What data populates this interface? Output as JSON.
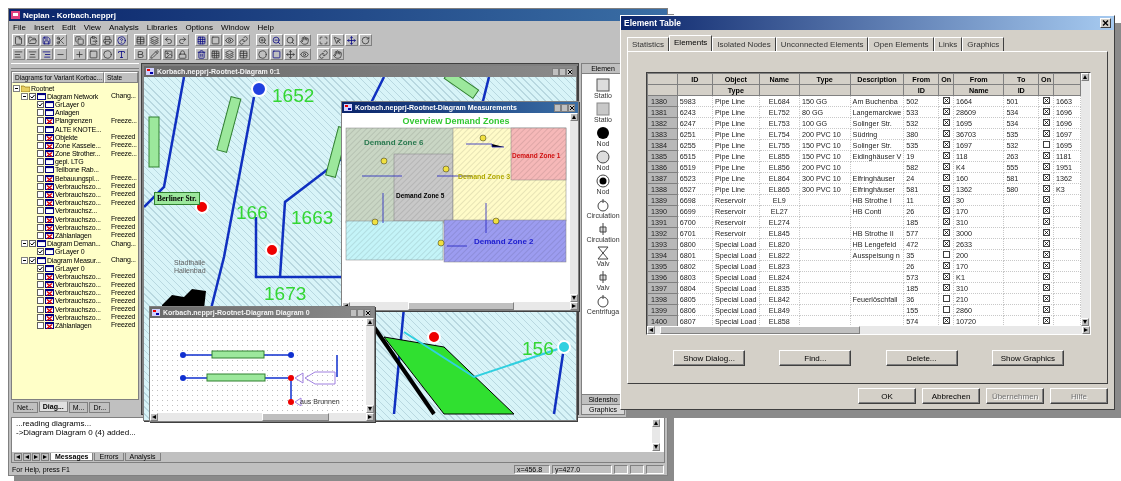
{
  "main_window": {
    "title": "Neplan - Korbach.nepprj",
    "menu": [
      "File",
      "Insert",
      "Edit",
      "View",
      "Analysis",
      "Libraries",
      "Options",
      "Window",
      "Help"
    ],
    "tree_panel": {
      "columns": [
        "Diagrams for Variant Korbac...",
        "State"
      ],
      "items": [
        {
          "label": "Rootnet",
          "kind": "folder",
          "expanded": true,
          "children": [
            {
              "label": "Diagram Network",
              "kind": "diagram",
              "checked": true,
              "state": "Chang...",
              "expanded": true,
              "children": [
                {
                  "label": "GrLayer 0",
                  "kind": "layer",
                  "checked": true
                },
                {
                  "label": "Anlagen",
                  "kind": "layer",
                  "checked": false
                },
                {
                  "label": "Plangrenzen",
                  "kind": "frozen-layer",
                  "checked": false,
                  "state": "Freeze..."
                },
                {
                  "label": "ALTE KNOTE...",
                  "kind": "layer",
                  "checked": false
                },
                {
                  "label": "Objekte",
                  "kind": "frozen-layer",
                  "checked": false,
                  "state": "Freezed"
                },
                {
                  "label": "Zone Kassele...",
                  "kind": "frozen-layer",
                  "checked": false,
                  "state": "Freeze..."
                },
                {
                  "label": "Zone Strother...",
                  "kind": "frozen-layer",
                  "checked": false,
                  "state": "Freeze..."
                },
                {
                  "label": "gepl. LTG",
                  "kind": "layer",
                  "checked": false
                },
                {
                  "label": "Teilbone Rab...",
                  "kind": "layer",
                  "checked": false
                },
                {
                  "label": "Bebauungspl...",
                  "kind": "frozen-layer",
                  "checked": false,
                  "state": "Freeze..."
                },
                {
                  "label": "Verbrauchszo...",
                  "kind": "frozen-layer",
                  "checked": false,
                  "state": "Freezed"
                },
                {
                  "label": "Verbrauchszo...",
                  "kind": "frozen-layer",
                  "checked": false,
                  "state": "Freezed"
                },
                {
                  "label": "Verbrauchszo...",
                  "kind": "frozen-layer",
                  "checked": false,
                  "state": "Freezed"
                },
                {
                  "label": "Verbrauchsz...",
                  "kind": "layer",
                  "checked": false
                },
                {
                  "label": "Verbrauchszo...",
                  "kind": "frozen-layer",
                  "checked": false,
                  "state": "Freezed"
                },
                {
                  "label": "Verbrauchszo...",
                  "kind": "frozen-layer",
                  "checked": false,
                  "state": "Freezed"
                },
                {
                  "label": "Zählanlagen",
                  "kind": "frozen-layer",
                  "checked": false,
                  "state": "Freezed"
                }
              ]
            },
            {
              "label": "Diagram Deman...",
              "kind": "diagram",
              "checked": true,
              "state": "Chang...",
              "expanded": true,
              "children": [
                {
                  "label": "GrLayer 0",
                  "kind": "layer",
                  "checked": true
                }
              ]
            },
            {
              "label": "Diagram Measur...",
              "kind": "diagram",
              "checked": true,
              "state": "Chang...",
              "expanded": true,
              "children": [
                {
                  "label": "GrLayer 0",
                  "kind": "layer",
                  "checked": true
                },
                {
                  "label": "Verbrauchszo...",
                  "kind": "frozen-layer",
                  "checked": false,
                  "state": "Freezed"
                },
                {
                  "label": "Verbrauchszo...",
                  "kind": "frozen-layer",
                  "checked": false,
                  "state": "Freezed"
                },
                {
                  "label": "Verbrauchszo...",
                  "kind": "frozen-layer",
                  "checked": false,
                  "state": "Freezed"
                },
                {
                  "label": "Verbrauchszo...",
                  "kind": "frozen-layer",
                  "checked": false,
                  "state": "Freezed"
                },
                {
                  "label": "Verbrauchszo...",
                  "kind": "frozen-layer",
                  "checked": false,
                  "state": "Freezed"
                },
                {
                  "label": "Verbrauchszo...",
                  "kind": "frozen-layer",
                  "checked": false,
                  "state": "Freezed"
                },
                {
                  "label": "Zählanlagen",
                  "kind": "frozen-layer",
                  "checked": false,
                  "state": "Freezed"
                }
              ]
            }
          ]
        }
      ],
      "tabs": [
        {
          "label": "Net...",
          "selected": false
        },
        {
          "label": "Diag...",
          "selected": true
        },
        {
          "label": "M...",
          "selected": false
        },
        {
          "label": "Dr...",
          "selected": false
        }
      ]
    },
    "network_diagram": {
      "title": "Korbach.nepprj-Rootnet-Diagram 0:1",
      "active": false,
      "numbers": [
        "1652",
        "166",
        "1663",
        "1673",
        "156"
      ],
      "building_label": [
        "Stadthalle",
        "Hallenbad"
      ],
      "street_label": "Berliner Str."
    },
    "measurements_diagram": {
      "title": "Korbach.nepprj-Rootnet-Diagram Measurements",
      "active": true,
      "heading": "Overview Demand Zones",
      "zones": [
        {
          "label": "Demand Zone 6",
          "color": "#c9d6c4"
        },
        {
          "label": "Demand Zone 5",
          "color": "#c8c8c8"
        },
        {
          "label": "Demand Zone 3",
          "color": "#fffbc8"
        },
        {
          "label": "Demand Zone 1",
          "color": "#f6b8b8"
        },
        {
          "color": "#c4f4f8"
        },
        {
          "label": "Demand Zone 2",
          "color": "#9c9cf0"
        }
      ]
    },
    "schematic_diagram": {
      "title": "Korbach.nepprj-Rootnet-Diagram Diagram 0",
      "active": false,
      "labels": [
        "aus Brunnen"
      ]
    },
    "palette": {
      "header": "Elemen",
      "items": [
        "Statio",
        "Statio",
        "Nod",
        "Nod",
        "Nod",
        "Circulation",
        "Circulation",
        "Valv",
        "Valv",
        "Centrifuga"
      ],
      "tabs": [
        {
          "label": "Sidensho",
          "selected": false
        },
        {
          "label": "Graphics",
          "selected": true
        }
      ]
    },
    "messages": {
      "lines": [
        "...reading diagrams...",
        "->Diagram Diagram 0 (4) added..."
      ],
      "tabs": [
        {
          "label": "Messages",
          "selected": true
        },
        {
          "label": "Errors",
          "selected": false
        },
        {
          "label": "Analysis",
          "selected": false
        }
      ]
    },
    "status_bar": {
      "help": "For Help, press F1",
      "x": "x=456.8",
      "y": "y=427.0"
    }
  },
  "element_table": {
    "title": "Element Table",
    "tabs": [
      {
        "label": "Statistics",
        "selected": false
      },
      {
        "label": "Elements",
        "selected": true
      },
      {
        "label": "Isolated Nodes",
        "selected": false
      },
      {
        "label": "Unconnected Elements",
        "selected": false
      },
      {
        "label": "Open Elements",
        "selected": false
      },
      {
        "label": "Links",
        "selected": false
      },
      {
        "label": "Graphics",
        "selected": false
      }
    ],
    "header_rows": [
      [
        null,
        "ID",
        "Object",
        "Name",
        "Type",
        "Description",
        "From",
        "On",
        "From",
        "To",
        "On",
        null
      ],
      [
        null,
        null,
        "Type",
        null,
        null,
        null,
        "ID",
        null,
        "Name",
        "ID",
        null,
        null
      ]
    ],
    "rows": [
      {
        "cells": [
          "1380",
          "5983",
          "Pipe Line",
          "EL684",
          "150 GG",
          "Am Buchenba",
          "502",
          true,
          "1664",
          "501",
          true,
          "1663"
        ]
      },
      {
        "cells": [
          "1381",
          "6243",
          "Pipe Line",
          "EL752",
          "80 GG",
          "Langemarckwe",
          "533",
          true,
          "28609",
          "534",
          true,
          "1696"
        ]
      },
      {
        "cells": [
          "1382",
          "6247",
          "Pipe Line",
          "EL753",
          "100 GG",
          "Solinger Str.",
          "532",
          true,
          "1695",
          "534",
          true,
          "1696"
        ]
      },
      {
        "cells": [
          "1383",
          "6251",
          "Pipe Line",
          "EL754",
          "200 PVC 10",
          "Südring",
          "380",
          true,
          "36703",
          "535",
          true,
          "1697"
        ]
      },
      {
        "cells": [
          "1384",
          "6255",
          "Pipe Line",
          "EL755",
          "150 PVC 10",
          "Solinger Str.",
          "535",
          true,
          "1697",
          "532",
          false,
          "1695"
        ]
      },
      {
        "cells": [
          "1385",
          "6515",
          "Pipe Line",
          "EL855",
          "150 PVC 10",
          "Eidinghäuser V",
          "19",
          true,
          "118",
          "263",
          true,
          "1181"
        ]
      },
      {
        "cells": [
          "1386",
          "6519",
          "Pipe Line",
          "EL856",
          "200 PVC 10",
          null,
          "582",
          true,
          "K4",
          "555",
          true,
          "1951"
        ]
      },
      {
        "cells": [
          "1387",
          "6523",
          "Pipe Line",
          "EL864",
          "300 PVC 10",
          "Elfringhäuser",
          "24",
          true,
          "160",
          "581",
          true,
          "1362"
        ]
      },
      {
        "cells": [
          "1388",
          "6527",
          "Pipe Line",
          "EL865",
          "300 PVC 10",
          "Elfringhäuser",
          "581",
          true,
          "1362",
          "580",
          true,
          "K3"
        ]
      },
      {
        "cells": [
          "1389",
          "6698",
          "Reservoir",
          "EL9",
          null,
          "HB Strothe I",
          "11",
          true,
          "30",
          null,
          true,
          null
        ]
      },
      {
        "cells": [
          "1390",
          "6699",
          "Reservoir",
          "EL27",
          null,
          "HB Conti",
          "26",
          true,
          "170",
          null,
          true,
          null
        ]
      },
      {
        "cells": [
          "1391",
          "6700",
          "Reservoir",
          "EL274",
          null,
          null,
          "185",
          true,
          "310",
          null,
          true,
          null
        ]
      },
      {
        "cells": [
          "1392",
          "6701",
          "Reservoir",
          "EL845",
          null,
          "HB Strothe II",
          "577",
          true,
          "3000",
          null,
          true,
          null
        ]
      },
      {
        "cells": [
          "1393",
          "6800",
          "Special Load",
          "EL820",
          null,
          "HB Lengefeld",
          "472",
          true,
          "2633",
          null,
          true,
          null
        ]
      },
      {
        "cells": [
          "1394",
          "6801",
          "Special Load",
          "EL822",
          null,
          "Ausspeisung n",
          "35",
          false,
          "200",
          null,
          true,
          null
        ]
      },
      {
        "cells": [
          "1395",
          "6802",
          "Special Load",
          "EL823",
          null,
          null,
          "26",
          true,
          "170",
          null,
          true,
          null
        ]
      },
      {
        "cells": [
          "1396",
          "6803",
          "Special Load",
          "EL824",
          null,
          null,
          "573",
          true,
          "K1",
          null,
          true,
          null
        ]
      },
      {
        "cells": [
          "1397",
          "6804",
          "Special Load",
          "EL835",
          null,
          null,
          "185",
          true,
          "310",
          null,
          true,
          null
        ]
      },
      {
        "cells": [
          "1398",
          "6805",
          "Special Load",
          "EL842",
          null,
          "Feuerlöschfall",
          "36",
          false,
          "210",
          null,
          true,
          null
        ]
      },
      {
        "cells": [
          "1399",
          "6806",
          "Special Load",
          "EL849",
          null,
          null,
          "155",
          false,
          "2860",
          null,
          true,
          null
        ]
      },
      {
        "cells": [
          "1400",
          "6807",
          "Special Load",
          "EL858",
          null,
          null,
          "574",
          true,
          "10720",
          null,
          true,
          null
        ]
      }
    ],
    "actions": [
      "Show Dialog...",
      "Find...",
      "Delete...",
      "Show Graphics"
    ],
    "buttons": [
      {
        "label": "OK",
        "disabled": false
      },
      {
        "label": "Abbrechen",
        "disabled": false
      },
      {
        "label": "Übernehmen",
        "disabled": true
      },
      {
        "label": "Hilfe",
        "disabled": true
      }
    ]
  }
}
